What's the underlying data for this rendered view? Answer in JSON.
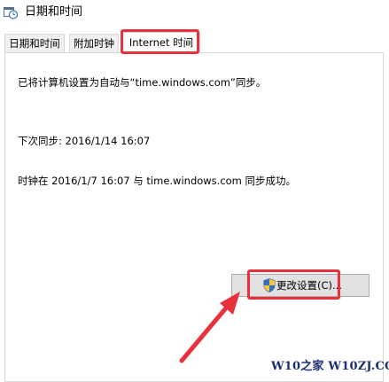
{
  "window": {
    "title": "日期和时间",
    "icon": "clock-calendar-icon"
  },
  "tabs": [
    {
      "label": "日期和时间",
      "active": false
    },
    {
      "label": "附加时钟",
      "active": false
    },
    {
      "label": "Internet 时间",
      "active": true
    }
  ],
  "internet_time": {
    "sync_info": "已将计算机设置为自动与“time.windows.com”同步。",
    "next_sync": "下次同步: 2016/1/14 16:07",
    "last_sync": "时钟在 2016/1/7 16:07 与 time.windows.com 同步成功。",
    "change_settings_button": "更改设置(C)...",
    "button_icon": "uac-shield-icon"
  },
  "annotations": {
    "highlight_color": "#e8313c",
    "arrow_color": "#e8313c"
  },
  "watermark": {
    "text": "W10之家 W10ZJ.COM",
    "color": "#1a2f6e"
  }
}
